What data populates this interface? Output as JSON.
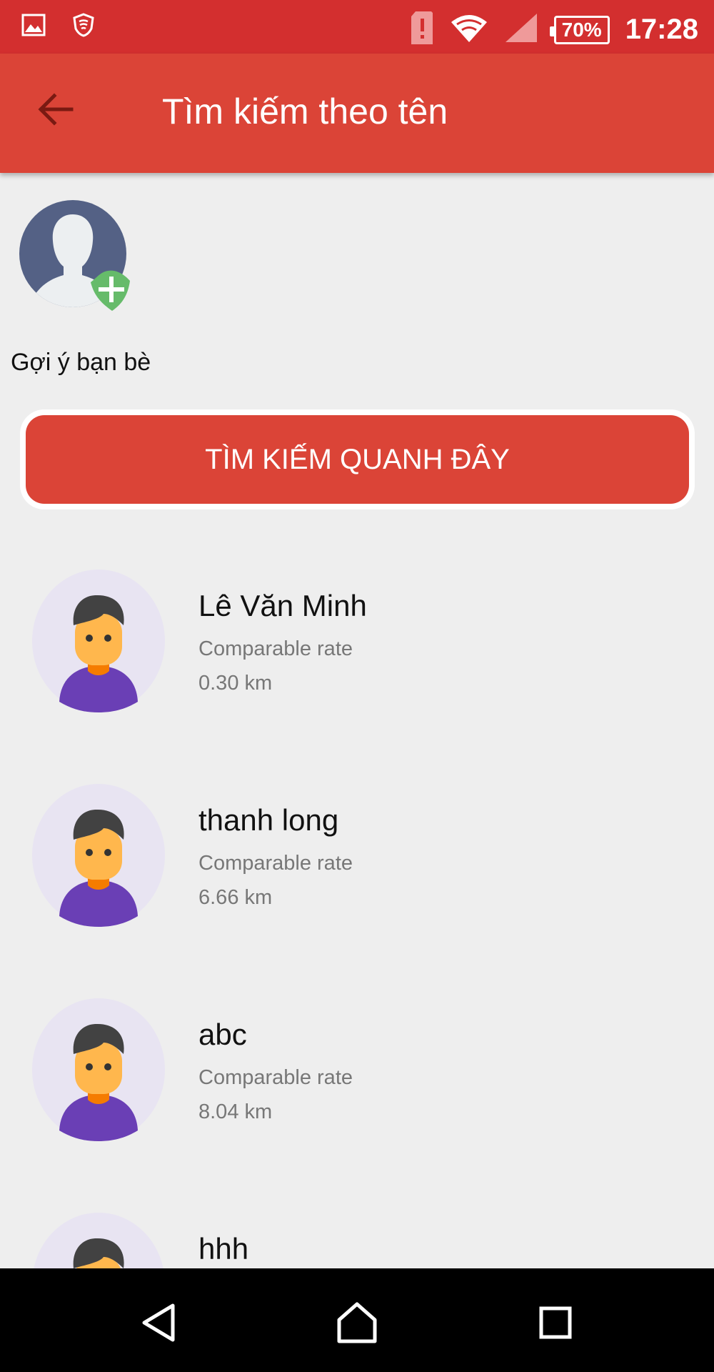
{
  "status_bar": {
    "battery": "70%",
    "time": "17:28",
    "icons": [
      "gallery-icon",
      "shield-icon",
      "sim-alert-icon",
      "wifi-icon",
      "signal-icon",
      "battery-icon"
    ]
  },
  "app_bar": {
    "title": "Tìm kiếm theo tên",
    "back_icon": "arrow-back-icon"
  },
  "suggestion": {
    "label": "Gợi ý bạn bè",
    "icon": "add-friend-icon"
  },
  "search_nearby": {
    "label": "TÌM KIẾM QUANH ĐÂY"
  },
  "results": [
    {
      "name": "Lê Văn Minh",
      "subtitle": "Comparable rate",
      "distance": "0.30 km"
    },
    {
      "name": "thanh long",
      "subtitle": "Comparable rate",
      "distance": "6.66 km"
    },
    {
      "name": "abc",
      "subtitle": "Comparable rate",
      "distance": "8.04 km"
    },
    {
      "name": "hhh",
      "subtitle": "",
      "distance": ""
    }
  ],
  "colors": {
    "status_bar": "#D32F2F",
    "app_bar": "#DB4437",
    "background": "#EEEEEE",
    "accent_green": "#66BB6A",
    "avatar_bg": "#E8E4F2",
    "avatar_shirt": "#6A3FB5",
    "avatar_skin": "#FFB74D"
  },
  "nav_bar": {
    "icons": [
      "back-triangle-icon",
      "home-icon",
      "recents-icon"
    ]
  }
}
